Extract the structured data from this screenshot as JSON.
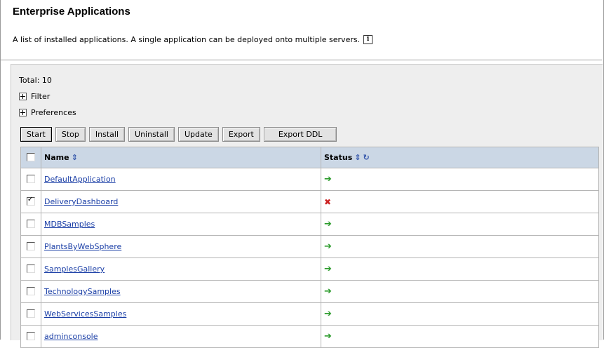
{
  "page": {
    "title": "Enterprise Applications",
    "description": "A list of installed applications. A single application can be deployed onto multiple servers."
  },
  "summary": {
    "total_label": "Total: 10",
    "filter_label": "Filter",
    "preferences_label": "Preferences"
  },
  "toolbar": {
    "start": "Start",
    "stop": "Stop",
    "install": "Install",
    "uninstall": "Uninstall",
    "update": "Update",
    "export": "Export",
    "export_ddl": "Export DDL"
  },
  "table": {
    "columns": {
      "name": "Name",
      "status": "Status"
    },
    "rows": [
      {
        "name": "DefaultApplication",
        "status": "started",
        "checked": false
      },
      {
        "name": "DeliveryDashboard",
        "status": "stopped",
        "checked": true
      },
      {
        "name": "MDBSamples",
        "status": "started",
        "checked": false
      },
      {
        "name": "PlantsByWebSphere",
        "status": "started",
        "checked": false
      },
      {
        "name": "SamplesGallery",
        "status": "started",
        "checked": false
      },
      {
        "name": "TechnologySamples",
        "status": "started",
        "checked": false
      },
      {
        "name": "WebServicesSamples",
        "status": "started",
        "checked": false
      },
      {
        "name": "adminconsole",
        "status": "started",
        "checked": false
      }
    ]
  },
  "icons": {
    "status_started": "green-arrow-icon",
    "status_stopped": "red-x-icon",
    "sort": "sort-arrows-icon",
    "refresh": "refresh-icon",
    "info": "info-icon"
  },
  "colors": {
    "header_bg": "#cbd7e5",
    "link": "#1a3ea6",
    "status_started": "#2c9b2c",
    "status_stopped": "#cc2222",
    "panel_bg": "#eeeeee"
  }
}
